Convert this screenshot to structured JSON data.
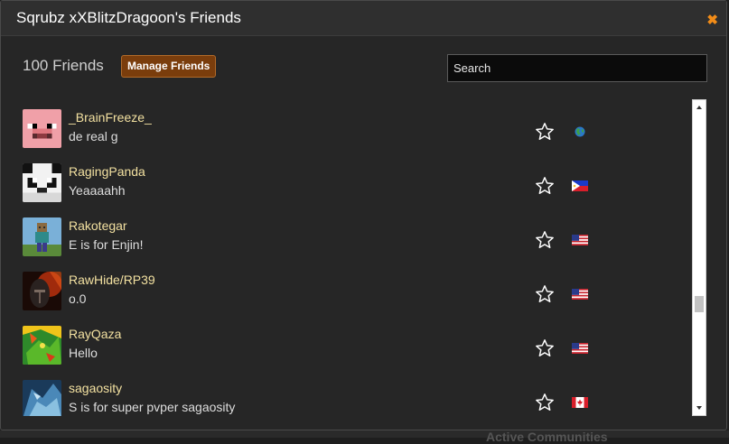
{
  "dialog": {
    "title": "Sqrubz xXBlitzDragoon's Friends",
    "close_icon": "close-icon"
  },
  "header": {
    "count_label": "100 Friends",
    "manage_label": "Manage Friends",
    "search_placeholder": "Search"
  },
  "colors": {
    "accent_orange": "#f28c18",
    "button_brown": "#7a3d0c",
    "name_color": "#f2e0a0",
    "background": "#262626"
  },
  "friends": [
    {
      "name": "_BrainFreeze_",
      "status": "de real g",
      "avatar": "pig-face-avatar",
      "flag": "globe-flag-icon"
    },
    {
      "name": "RagingPanda",
      "status": "Yeaaaahh",
      "avatar": "panda-face-avatar",
      "flag": "philippines-flag-icon"
    },
    {
      "name": "Rakotegar",
      "status": "E is for Enjin!",
      "avatar": "minecraft-character-avatar",
      "flag": "us-flag-icon"
    },
    {
      "name": "RawHide/RP39",
      "status": "o.0",
      "avatar": "dark-helmet-avatar",
      "flag": "us-flag-icon"
    },
    {
      "name": "RayQaza",
      "status": "Hello",
      "avatar": "green-dragon-avatar",
      "flag": "us-flag-icon"
    },
    {
      "name": "sagaosity",
      "status": "S is for super pvper sagaosity",
      "avatar": "blue-dragon-avatar",
      "flag": "canada-flag-icon"
    }
  ],
  "scroll": {
    "position_fraction": 0.62
  },
  "background_text": "Active Communities"
}
